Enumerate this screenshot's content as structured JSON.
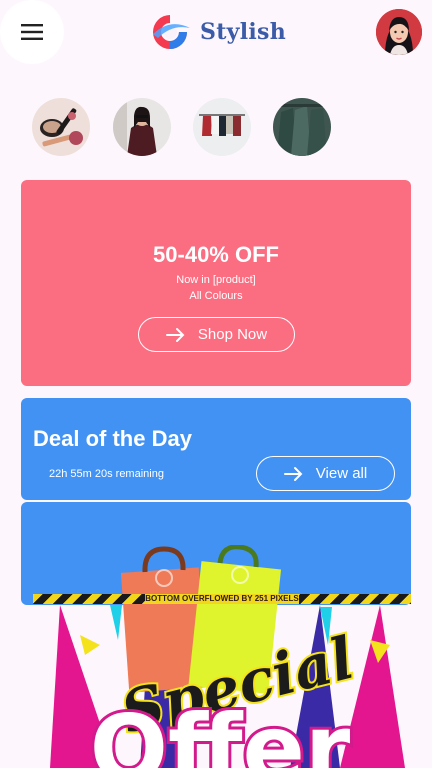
{
  "header": {
    "brand_name": "Stylish",
    "menu_icon": "hamburger-menu-icon",
    "avatar_icon": "user-avatar"
  },
  "categories": [
    {
      "icon": "makeup-category"
    },
    {
      "icon": "fashion-model-category"
    },
    {
      "icon": "clothes-rack-category"
    },
    {
      "icon": "shirts-category"
    }
  ],
  "promo": {
    "title": "50-40% OFF",
    "line1": "Now in [product]",
    "line2": "All Colours",
    "button_label": "Shop Now",
    "bg_color": "#fb6e82"
  },
  "deal": {
    "title": "Deal of the Day",
    "timer": "22h 55m 20s remaining",
    "button_label": "View all",
    "bg_color": "#4292f3"
  },
  "overflow_warning": "BOTTOM OVERFLOWED BY 251 PIXELS",
  "special_offer": {
    "line1": "Special",
    "line2": "Offer"
  }
}
